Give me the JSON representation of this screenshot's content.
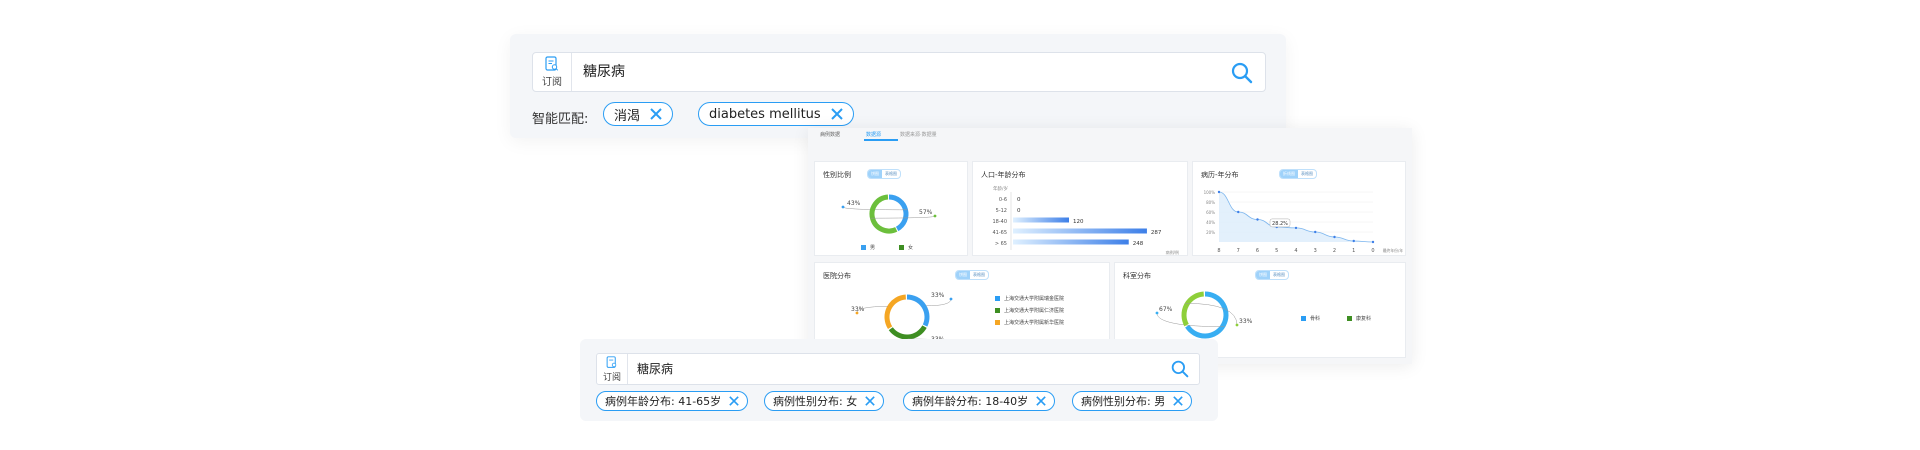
{
  "top_search": {
    "subscribe_label": "订阅",
    "query": "糖尿病",
    "match_label": "智能匹配:",
    "tags": [
      "消渴",
      "diabetes mellitus"
    ]
  },
  "dashboard": {
    "tabs": [
      "病例数据",
      "数据源",
      "数据来源·数据量"
    ],
    "toggle": [
      "饼图",
      "表格图"
    ],
    "gender": {
      "title": "性别比例",
      "slices": [
        {
          "label": "男",
          "value": 43,
          "pct": "43%",
          "color": "#3aa0f0"
        },
        {
          "label": "女",
          "value": 57,
          "pct": "57%",
          "color": "#5aa02c"
        }
      ]
    },
    "population": {
      "title": "人口-年龄分布",
      "ylabel": "年龄/岁",
      "xlabel": "病例/例",
      "categories": [
        "0-6",
        "5-12",
        "18-40",
        "41-65",
        "> 65"
      ],
      "values": [
        0,
        0,
        120,
        287,
        248
      ]
    },
    "disease_year": {
      "title": "病历-年分布",
      "toggle": [
        "折线图",
        "表格图"
      ],
      "yticks": [
        "100%",
        "80%",
        "60%",
        "40%",
        "20%"
      ],
      "x": [
        "8",
        "7",
        "6",
        "5",
        "4",
        "3",
        "2",
        "1",
        "0"
      ],
      "values": [
        100,
        60,
        45,
        30,
        28.2,
        20,
        10,
        2,
        0
      ],
      "annotation": "28.2%",
      "xlabel": "最终年份/年"
    },
    "hospital": {
      "title": "医院分布",
      "slices": [
        {
          "label": "上海交通大学附属瑞金医院",
          "value": 33,
          "pct": "33%",
          "color": "#2a9df4"
        },
        {
          "label": "上海交通大学附属仁济医院",
          "value": 33,
          "pct": "33%",
          "color": "#3e8e22"
        },
        {
          "label": "上海交通大学附属新华医院",
          "value": 34,
          "pct": "33%",
          "color": "#f5a623"
        }
      ]
    },
    "department": {
      "title": "科室分布",
      "slices": [
        {
          "label": "骨科",
          "value": 67,
          "pct": "67%",
          "color": "#2a9df4"
        },
        {
          "label": "康复科",
          "value": 33,
          "pct": "33%",
          "color": "#8ecf3a"
        }
      ]
    }
  },
  "bottom_search": {
    "subscribe_label": "订阅",
    "query": "糖尿病",
    "tags": [
      "病例年龄分布: 41-65岁",
      "病例性别分布: 女",
      "病例年龄分布: 18-40岁",
      "病例性别分布: 男"
    ]
  },
  "colors": {
    "accent": "#2a9df4",
    "panel_bg": "#f4f6f9"
  }
}
